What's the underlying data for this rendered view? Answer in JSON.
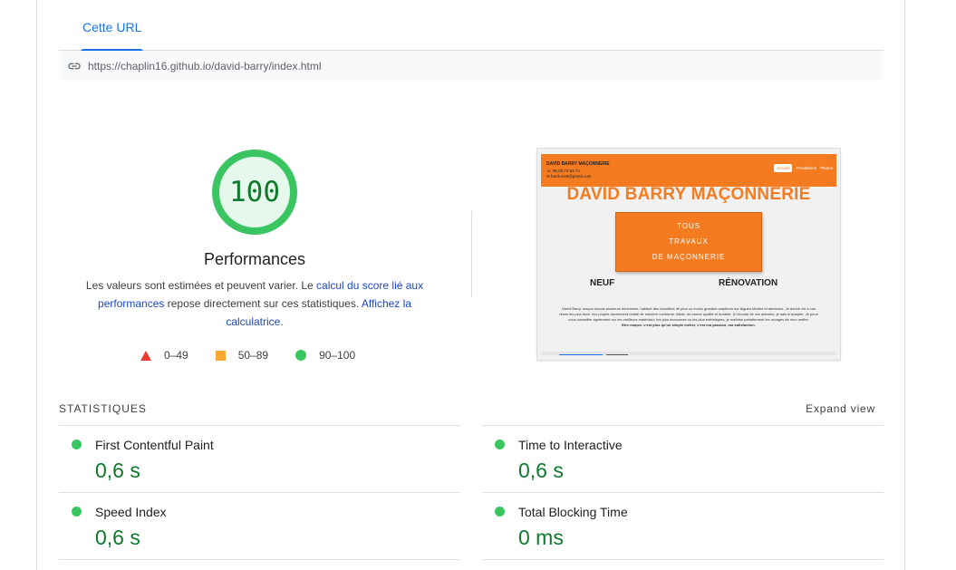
{
  "tabs": {
    "active_label": "Cette URL"
  },
  "url_bar": {
    "url": "https://chaplin16.github.io/david-barry/index.html",
    "icon": "link-icon"
  },
  "score": {
    "value": "100",
    "fraction": 1.0,
    "title": "Performances",
    "color": "#0d7a2c",
    "desc_part1": "Les valeurs sont estimées et peuvent varier. Le ",
    "desc_link1": "calcul du score lié aux performances",
    "desc_part2": " repose directement sur ces statistiques. ",
    "desc_link2": "Affichez la calculatrice",
    "desc_part3": "."
  },
  "legend": [
    {
      "icon": "red-triangle-icon",
      "label": "0–49",
      "color": "#eb3b30"
    },
    {
      "icon": "orange-square-icon",
      "label": "50–89",
      "color": "#f9a933"
    },
    {
      "icon": "green-circle-icon",
      "label": "90–100",
      "color": "#3bc560"
    }
  ],
  "screenshot": {
    "brand": "DAVID BARRY MAÇONNERIE",
    "phone": "06.00.73.63.72",
    "email": "barrtun40@gmail.com",
    "nav": [
      "Accueil",
      "Prestations",
      "Photos"
    ],
    "title": "DAVID BARRY MAÇONNERIE",
    "box_lines": [
      "TOUS",
      "TRAVAUX",
      "DE MAÇONNERIE"
    ],
    "left_word": "NEUF",
    "right_word": "RÉNOVATION",
    "paragraph": "David Barry, maçon depuis plusieurs décennies, habitué des chantiers de plus ou moins grandes ampleurs sur Aigues-Mortes et alentours. Je donne vie à vos rêves les plus fous! Vos projets deviennent réalité de manière conforme, fiable, de bonne qualité et durable. À l'écoute de vos attentes, je sais m'adapter. Je peux vous conseiller également sur les meilleurs matériaux, les plus économes ou les plus esthétiques, je maîtrise parfaitement les rouages de mon métier.",
    "tagline": "Etre maçon, c'est plus qu'un simple métier, c'est ma passion, ma satisfaction."
  },
  "stats": {
    "title": "STATISTIQUES",
    "expand_label": "Expand view",
    "metrics": [
      {
        "name": "First Contentful Paint",
        "value": "0,6 s",
        "status_color": "#3bc560"
      },
      {
        "name": "Time to Interactive",
        "value": "0,6 s",
        "status_color": "#3bc560"
      },
      {
        "name": "Speed Index",
        "value": "0,6 s",
        "status_color": "#3bc560"
      },
      {
        "name": "Total Blocking Time",
        "value": "0 ms",
        "status_color": "#3bc560"
      }
    ]
  }
}
